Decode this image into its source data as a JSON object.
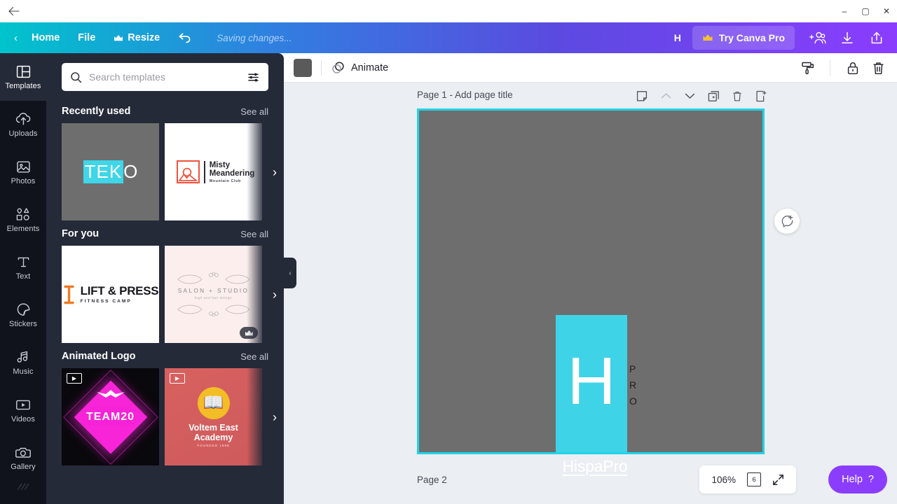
{
  "window": {
    "back_icon": "back-arrow-icon",
    "minimize": "–",
    "maximize": "▢",
    "close": "✕"
  },
  "topbar": {
    "back_chevron": "‹",
    "home_label": "Home",
    "file_label": "File",
    "resize_label": "Resize",
    "resize_icon": "crown-icon",
    "undo_icon": "undo-icon",
    "status_text": "Saving changes...",
    "avatar_initial": "H",
    "try_pro_label": "Try Canva Pro",
    "try_pro_icon": "crown-icon",
    "share_icon": "add-person-icon",
    "download_icon": "download-icon",
    "publish_icon": "upload-share-icon",
    "gradient_start": "#00c4cc",
    "gradient_end": "#8b3dff"
  },
  "rail": {
    "items": [
      {
        "label": "Templates",
        "icon": "templates-icon",
        "active": true
      },
      {
        "label": "Uploads",
        "icon": "upload-cloud-icon",
        "active": false
      },
      {
        "label": "Photos",
        "icon": "photo-icon",
        "active": false
      },
      {
        "label": "Elements",
        "icon": "shapes-icon",
        "active": false
      },
      {
        "label": "Text",
        "icon": "text-icon",
        "active": false
      },
      {
        "label": "Stickers",
        "icon": "sticker-icon",
        "active": false
      },
      {
        "label": "Music",
        "icon": "music-note-icon",
        "active": false
      },
      {
        "label": "Videos",
        "icon": "video-icon",
        "active": false
      },
      {
        "label": "Gallery",
        "icon": "camera-icon",
        "active": false
      }
    ]
  },
  "panel": {
    "search": {
      "placeholder": "Search templates",
      "search_icon": "search-icon",
      "filter_icon": "filter-sliders-icon"
    },
    "sections": [
      {
        "title": "Recently used",
        "see_all": "See all",
        "arrow": "›",
        "items": [
          {
            "name": "TEKO",
            "highlight": "TEK",
            "rest": "O"
          },
          {
            "name": "Misty Meandering",
            "line1": "Misty",
            "line2": "Meandering",
            "line3": "Mountain Club"
          }
        ]
      },
      {
        "title": "For you",
        "see_all": "See all",
        "arrow": "›",
        "items": [
          {
            "name": "LIFT & PRESS",
            "line1": "LIFT & PRESS",
            "line2": "FITNESS CAMP"
          },
          {
            "name": "SALON + STUDIO",
            "line1": "SALON + STUDIO",
            "line2": "high end hair design",
            "pro": true
          }
        ]
      },
      {
        "title": "Animated Logo",
        "see_all": "See all",
        "arrow": "›",
        "items": [
          {
            "name": "TEAM20",
            "line1": "TEAM20",
            "video": true
          },
          {
            "name": "Voltem East Academy",
            "line1": "Voltem East",
            "line2": "Academy",
            "line3": "FOUNDED 1988",
            "video": true
          }
        ]
      }
    ],
    "collapse_arrow": "‹"
  },
  "editor": {
    "toolbar": {
      "color_swatch": "#5a5a5a",
      "animate_label": "Animate",
      "animate_icon": "animate-circles-icon",
      "paint_roller_icon": "paint-roller-icon",
      "lock_icon": "lock-icon",
      "trash_icon": "trash-icon"
    },
    "page": {
      "title": "Page 1 - Add page title",
      "tools": [
        {
          "icon": "notes-icon",
          "dim": false
        },
        {
          "icon": "chevron-up-icon",
          "dim": true
        },
        {
          "icon": "chevron-down-icon",
          "dim": false
        },
        {
          "icon": "duplicate-page-icon",
          "dim": false
        },
        {
          "icon": "delete-page-icon",
          "dim": false
        },
        {
          "icon": "add-page-icon",
          "dim": false
        }
      ],
      "selection_color": "#20d4e8",
      "background_color": "#6e6e6e"
    },
    "design": {
      "logo_letter": "H",
      "logo_box_color": "#3fd3e8",
      "pro_letters": [
        "P",
        "R",
        "O"
      ],
      "brand_name": "HispaPro"
    },
    "comment_icon": "add-comment-icon",
    "page2_label": "Page 2"
  },
  "footer": {
    "zoom_level": "106%",
    "page_count": "6",
    "pages_icon": "pages-stack-icon",
    "fullscreen_icon": "fullscreen-icon",
    "help_label": "Help",
    "help_mark": "?",
    "help_color": "#8b3dff"
  }
}
